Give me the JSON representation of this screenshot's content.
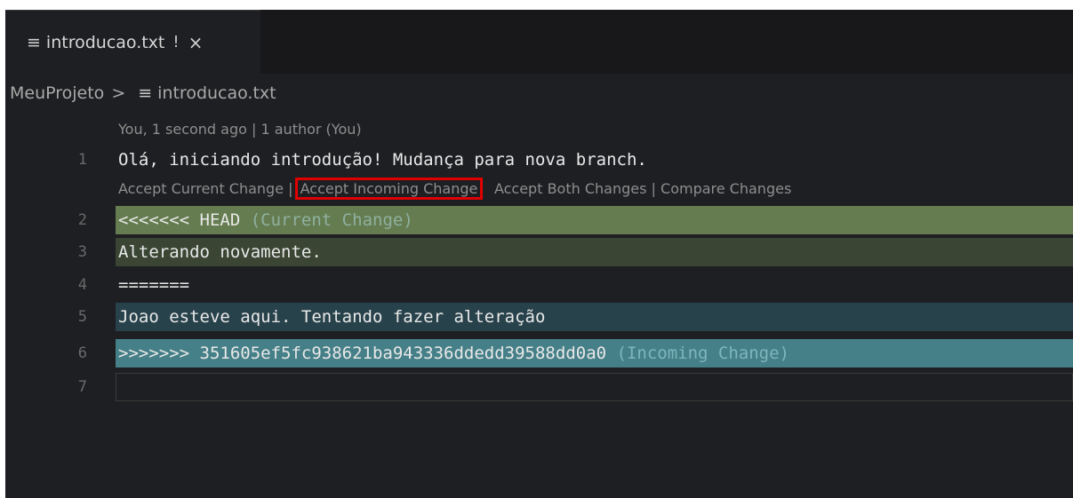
{
  "tab": {
    "icon": "lines-icon",
    "filename": "introducao.txt",
    "modified": "!",
    "close": "×"
  },
  "breadcrumb": {
    "project": "MeuProjeto",
    "sep": ">",
    "file": "introducao.txt"
  },
  "blame": "You, 1 second ago | 1 author (You)",
  "codelens": {
    "accept_current": "Accept Current Change",
    "sep": "|",
    "accept_incoming": "Accept Incoming Change",
    "accept_both": "Accept Both Changes",
    "compare": "Compare Changes"
  },
  "lines": [
    {
      "n": "1",
      "text": "Olá, iniciando introdução! Mudança para nova branch."
    },
    {
      "n": "2",
      "text": "<<<<<<< HEAD",
      "hint": "(Current Change)"
    },
    {
      "n": "3",
      "text": "Alterando novamente."
    },
    {
      "n": "4",
      "text": "======="
    },
    {
      "n": "5",
      "text": "Joao esteve aqui. Tentando fazer alteração"
    },
    {
      "n": "6",
      "text": ">>>>>>> 351605ef5fc938621ba943336ddedd39588dd0a0",
      "hint": "(Incoming Change)"
    },
    {
      "n": "7",
      "text": ""
    }
  ],
  "colors": {
    "current_header": "#647c4f",
    "current_body": "#3a4533",
    "incoming_body": "#28424b",
    "incoming_header": "#457f87",
    "highlight": "#e00000"
  }
}
